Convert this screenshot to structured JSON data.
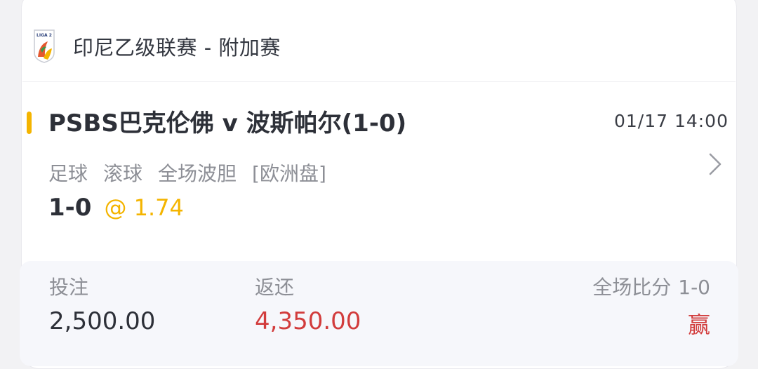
{
  "league": {
    "logo_icon": "liga-2-logo-icon",
    "logo_text": "LIGA 2",
    "title": "印尼乙级联赛 - 附加赛"
  },
  "match": {
    "title": "PSBS巴克伦佛 v 波斯帕尔(1-0)",
    "time": "01/17 14:00",
    "bet_types": [
      "足球",
      "滚球",
      "全场波胆",
      "[欧洲盘]"
    ],
    "pick": "1-0",
    "odds": "@ 1.74"
  },
  "summary": {
    "stake_label": "投注",
    "stake_value": "2,500.00",
    "return_label": "返还",
    "return_value": "4,350.00",
    "result_label": "全场比分",
    "result_score": "1-0",
    "result_status": "赢"
  },
  "colors": {
    "accent": "#f4b400",
    "win_red": "#d23c3c",
    "text_dark": "#2d3038",
    "text_muted": "#8d8f96"
  }
}
